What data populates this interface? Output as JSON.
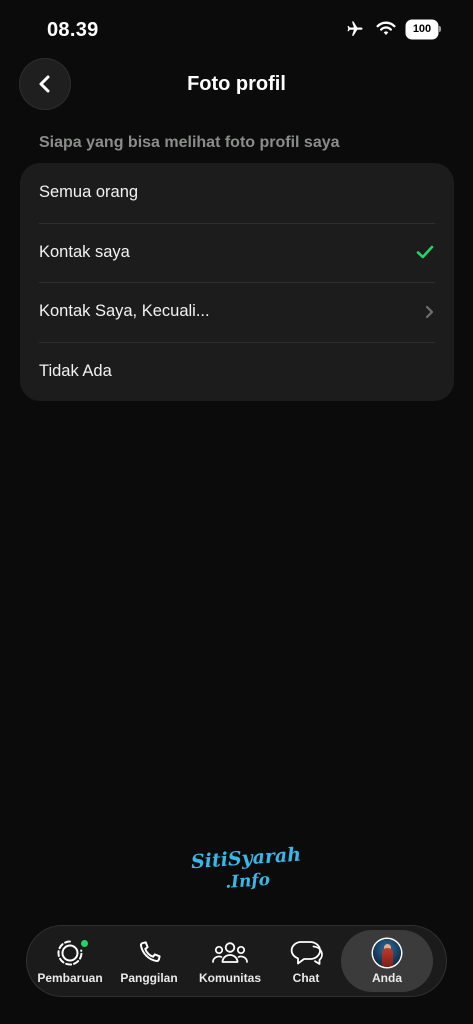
{
  "status_bar": {
    "time": "08.39",
    "battery": "100",
    "icons": [
      "airplane-icon",
      "wifi-icon",
      "battery-icon"
    ]
  },
  "header": {
    "title": "Foto profil",
    "back_icon": "chevron-left-icon"
  },
  "section": {
    "label": "Siapa yang bisa melihat foto profil saya",
    "options": [
      {
        "label": "Semua orang",
        "selected": false,
        "trailing": ""
      },
      {
        "label": "Kontak saya",
        "selected": true,
        "trailing": "checkmark-icon"
      },
      {
        "label": "Kontak Saya, Kecuali...",
        "selected": false,
        "trailing": "chevron-right-icon"
      },
      {
        "label": "Tidak Ada",
        "selected": false,
        "trailing": ""
      }
    ]
  },
  "watermark": {
    "line1": "SitiSyarah",
    "line2": ".Info"
  },
  "tab_bar": {
    "tabs": [
      {
        "label": "Pembaruan",
        "icon": "updates-icon",
        "badge": true,
        "active": false
      },
      {
        "label": "Panggilan",
        "icon": "phone-icon",
        "active": false
      },
      {
        "label": "Komunitas",
        "icon": "communities-icon",
        "active": false
      },
      {
        "label": "Chat",
        "icon": "chat-icon",
        "active": false
      },
      {
        "label": "Anda",
        "icon": "avatar",
        "active": true
      }
    ]
  },
  "colors": {
    "background": "#0b0b0b",
    "card": "#1b1c1b",
    "check": "#25d366",
    "badge": "#25d366",
    "section_label": "#8a8d8a",
    "watermark": "#39b7e6"
  }
}
